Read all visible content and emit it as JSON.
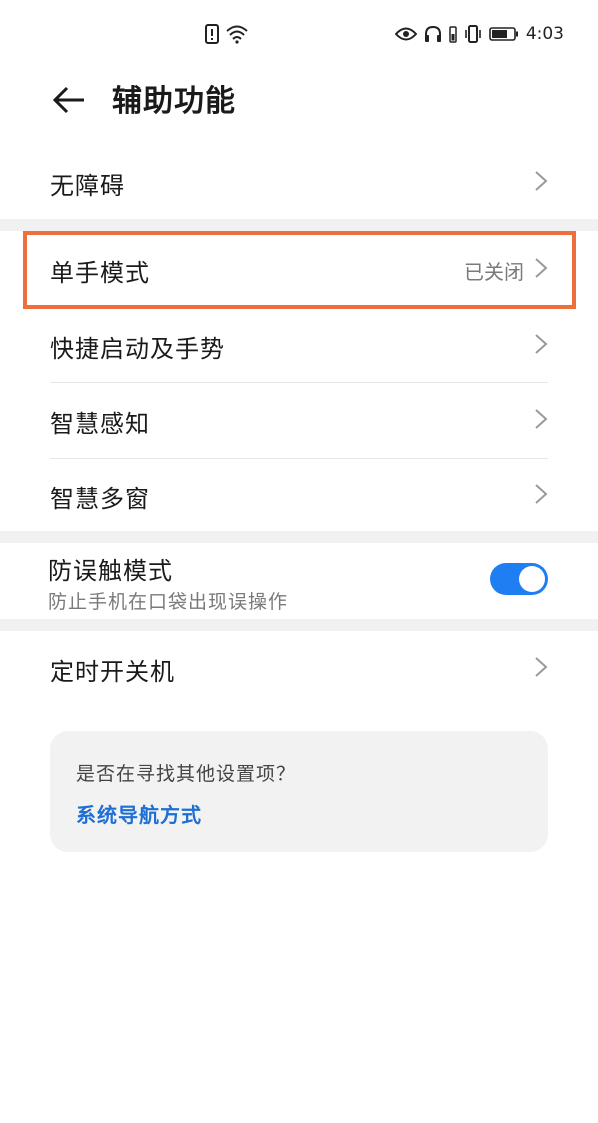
{
  "status_bar": {
    "time": "4:03",
    "left_icons": [
      "sim-alert-icon",
      "wifi-icon"
    ],
    "right_icons": [
      "eye-icon",
      "headphones-icon",
      "battery-small-icon",
      "vibrate-icon",
      "battery-icon"
    ]
  },
  "header": {
    "title": "辅助功能"
  },
  "items": {
    "accessibility": {
      "label": "无障碍"
    },
    "one_hand": {
      "label": "单手模式",
      "value": "已关闭"
    },
    "quick_launch": {
      "label": "快捷启动及手势"
    },
    "smart_sense": {
      "label": "智慧感知"
    },
    "smart_multiwindow": {
      "label": "智慧多窗"
    },
    "pocket_mode": {
      "label": "防误触模式",
      "description": "防止手机在口袋出现误操作",
      "enabled": true
    },
    "scheduled_power": {
      "label": "定时开关机"
    }
  },
  "suggestion": {
    "question": "是否在寻找其他设置项？",
    "link": "系统导航方式"
  },
  "colors": {
    "accent": "#1e7ef2",
    "highlight": "#ee6f3b",
    "link": "#1e6fd4"
  }
}
